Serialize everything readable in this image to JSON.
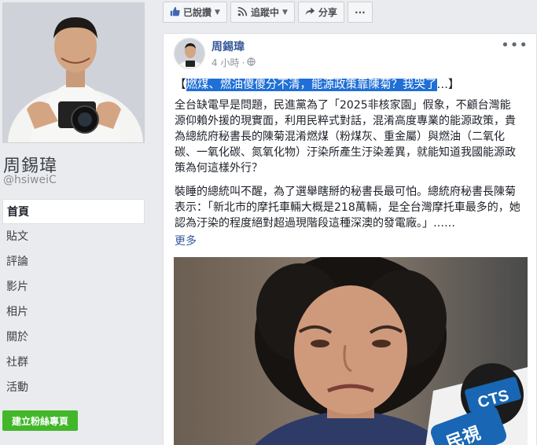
{
  "page": {
    "name": "周錫瑋",
    "handle": "@hsiweiC"
  },
  "nav": {
    "items": [
      {
        "label": "首頁",
        "active": true
      },
      {
        "label": "貼文"
      },
      {
        "label": "評論"
      },
      {
        "label": "影片"
      },
      {
        "label": "相片"
      },
      {
        "label": "關於"
      },
      {
        "label": "社群"
      },
      {
        "label": "活動"
      }
    ]
  },
  "create_page_button": "建立粉絲專頁",
  "actions": {
    "liked": "已說讚",
    "following": "追蹤中",
    "share": "分享",
    "more": "···"
  },
  "post": {
    "author": "周錫瑋",
    "time": "4 小時",
    "separator": "·",
    "menu": "•••",
    "title_open": "【",
    "title_highlight": "燃煤、燃油傻傻分不清，能源政策靠陳菊？我哭了",
    "title_rest": "…】",
    "paragraph1": "全台缺電早是問題，民進黨為了「2025非核家園」假象，不顧台灣能源仰賴外援的現實面，利用民粹式對話，混淆高度專業的能源政策，貴為總統府秘書長的陳菊混淆燃煤（粉煤灰、重金屬）與燃油（二氧化碳、一氧化碳、氮氧化物）汙染所產生汙染差異，就能知道我國能源政策為何這樣外行？",
    "paragraph2": "裝睡的總統叫不醒，為了選舉瞎掰的秘書長最可怕。總統府秘書長陳菊表示：「新北市的摩托車輛大概是218萬輛，是全台灣摩托車最多的，她認為汙染的程度絕對超過現階段這種深澳的發電廠。」……",
    "see_more": "更多",
    "image_mic_label_1": "CTS",
    "image_mic_label_2": "民視"
  },
  "colors": {
    "link": "#365899",
    "highlight": "#1f6fd6",
    "create_button": "#42b72a",
    "page_bg": "#e9ebee"
  },
  "icons": {
    "liked": "thumbs-up-icon",
    "following": "rss-icon",
    "share": "share-arrow-icon",
    "privacy": "globe-icon"
  }
}
